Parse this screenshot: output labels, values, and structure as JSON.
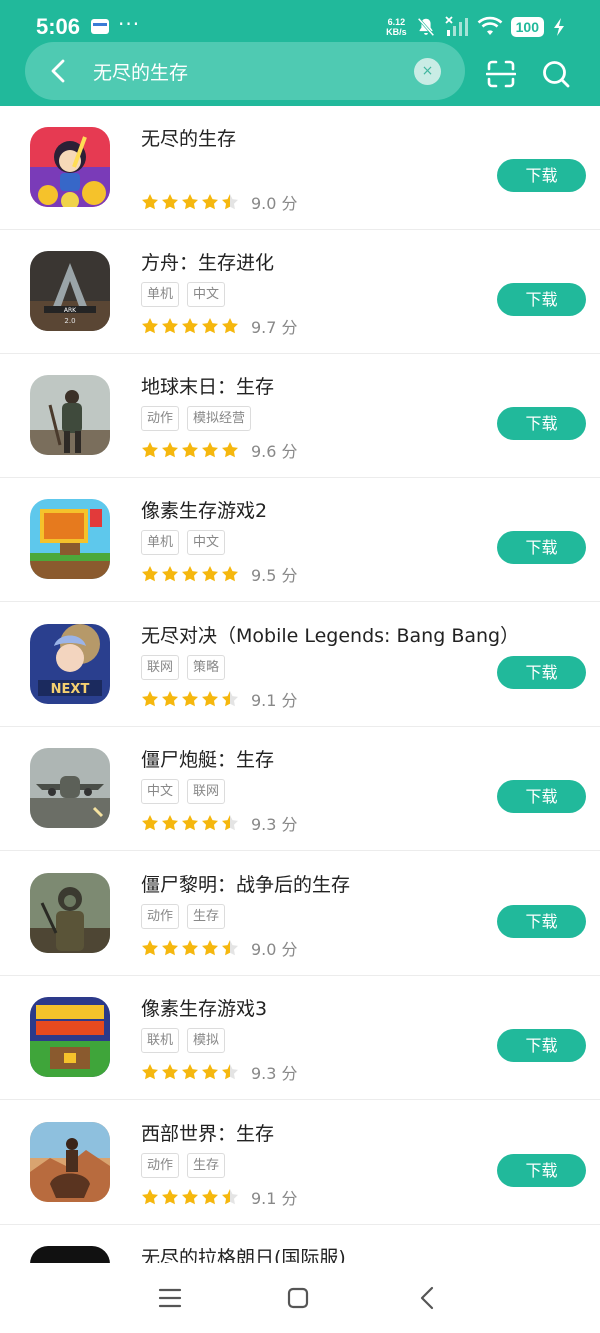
{
  "status": {
    "time": "5:06",
    "dots": "···",
    "net_speed_value": "6.12",
    "net_speed_unit": "KB/s",
    "battery": "100"
  },
  "search": {
    "query": "无尽的生存",
    "clear_glyph": "×"
  },
  "colors": {
    "accent": "#21b99b",
    "star": "#f5b70e"
  },
  "download_label": "下载",
  "score_unit": "分",
  "apps": [
    {
      "name": "无尽的生存",
      "tags": [],
      "stars": 4.5,
      "score": "9.0"
    },
    {
      "name": "方舟：生存进化",
      "tags": [
        "单机",
        "中文"
      ],
      "stars": 5,
      "score": "9.7"
    },
    {
      "name": "地球末日：生存",
      "tags": [
        "动作",
        "模拟经营"
      ],
      "stars": 5,
      "score": "9.6"
    },
    {
      "name": "像素生存游戏2",
      "tags": [
        "单机",
        "中文"
      ],
      "stars": 5,
      "score": "9.5"
    },
    {
      "name": "无尽对决（Mobile Legends: Bang Bang）",
      "tags": [
        "联网",
        "策略"
      ],
      "stars": 4.5,
      "score": "9.1"
    },
    {
      "name": "僵尸炮艇：生存",
      "tags": [
        "中文",
        "联网"
      ],
      "stars": 4.5,
      "score": "9.3"
    },
    {
      "name": "僵尸黎明：战争后的生存",
      "tags": [
        "动作",
        "生存"
      ],
      "stars": 4.5,
      "score": "9.0"
    },
    {
      "name": "像素生存游戏3",
      "tags": [
        "联机",
        "模拟"
      ],
      "stars": 4.5,
      "score": "9.3"
    },
    {
      "name": "西部世界：生存",
      "tags": [
        "动作",
        "生存"
      ],
      "stars": 4.5,
      "score": "9.1"
    },
    {
      "name": "无尽的拉格朗日(国际服)",
      "tags": [],
      "stars": 0,
      "score": ""
    }
  ]
}
